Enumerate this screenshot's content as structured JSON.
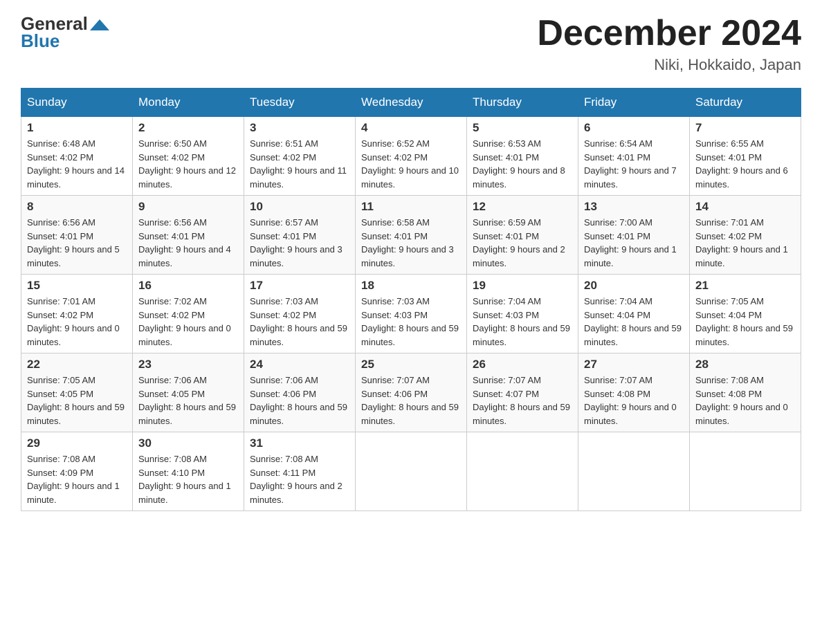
{
  "header": {
    "logo_text_1": "General",
    "logo_text_2": "Blue",
    "month_title": "December 2024",
    "location": "Niki, Hokkaido, Japan"
  },
  "weekdays": [
    "Sunday",
    "Monday",
    "Tuesday",
    "Wednesday",
    "Thursday",
    "Friday",
    "Saturday"
  ],
  "weeks": [
    [
      {
        "day": "1",
        "sunrise": "6:48 AM",
        "sunset": "4:02 PM",
        "daylight": "9 hours and 14 minutes."
      },
      {
        "day": "2",
        "sunrise": "6:50 AM",
        "sunset": "4:02 PM",
        "daylight": "9 hours and 12 minutes."
      },
      {
        "day": "3",
        "sunrise": "6:51 AM",
        "sunset": "4:02 PM",
        "daylight": "9 hours and 11 minutes."
      },
      {
        "day": "4",
        "sunrise": "6:52 AM",
        "sunset": "4:02 PM",
        "daylight": "9 hours and 10 minutes."
      },
      {
        "day": "5",
        "sunrise": "6:53 AM",
        "sunset": "4:01 PM",
        "daylight": "9 hours and 8 minutes."
      },
      {
        "day": "6",
        "sunrise": "6:54 AM",
        "sunset": "4:01 PM",
        "daylight": "9 hours and 7 minutes."
      },
      {
        "day": "7",
        "sunrise": "6:55 AM",
        "sunset": "4:01 PM",
        "daylight": "9 hours and 6 minutes."
      }
    ],
    [
      {
        "day": "8",
        "sunrise": "6:56 AM",
        "sunset": "4:01 PM",
        "daylight": "9 hours and 5 minutes."
      },
      {
        "day": "9",
        "sunrise": "6:56 AM",
        "sunset": "4:01 PM",
        "daylight": "9 hours and 4 minutes."
      },
      {
        "day": "10",
        "sunrise": "6:57 AM",
        "sunset": "4:01 PM",
        "daylight": "9 hours and 3 minutes."
      },
      {
        "day": "11",
        "sunrise": "6:58 AM",
        "sunset": "4:01 PM",
        "daylight": "9 hours and 3 minutes."
      },
      {
        "day": "12",
        "sunrise": "6:59 AM",
        "sunset": "4:01 PM",
        "daylight": "9 hours and 2 minutes."
      },
      {
        "day": "13",
        "sunrise": "7:00 AM",
        "sunset": "4:01 PM",
        "daylight": "9 hours and 1 minute."
      },
      {
        "day": "14",
        "sunrise": "7:01 AM",
        "sunset": "4:02 PM",
        "daylight": "9 hours and 1 minute."
      }
    ],
    [
      {
        "day": "15",
        "sunrise": "7:01 AM",
        "sunset": "4:02 PM",
        "daylight": "9 hours and 0 minutes."
      },
      {
        "day": "16",
        "sunrise": "7:02 AM",
        "sunset": "4:02 PM",
        "daylight": "9 hours and 0 minutes."
      },
      {
        "day": "17",
        "sunrise": "7:03 AM",
        "sunset": "4:02 PM",
        "daylight": "8 hours and 59 minutes."
      },
      {
        "day": "18",
        "sunrise": "7:03 AM",
        "sunset": "4:03 PM",
        "daylight": "8 hours and 59 minutes."
      },
      {
        "day": "19",
        "sunrise": "7:04 AM",
        "sunset": "4:03 PM",
        "daylight": "8 hours and 59 minutes."
      },
      {
        "day": "20",
        "sunrise": "7:04 AM",
        "sunset": "4:04 PM",
        "daylight": "8 hours and 59 minutes."
      },
      {
        "day": "21",
        "sunrise": "7:05 AM",
        "sunset": "4:04 PM",
        "daylight": "8 hours and 59 minutes."
      }
    ],
    [
      {
        "day": "22",
        "sunrise": "7:05 AM",
        "sunset": "4:05 PM",
        "daylight": "8 hours and 59 minutes."
      },
      {
        "day": "23",
        "sunrise": "7:06 AM",
        "sunset": "4:05 PM",
        "daylight": "8 hours and 59 minutes."
      },
      {
        "day": "24",
        "sunrise": "7:06 AM",
        "sunset": "4:06 PM",
        "daylight": "8 hours and 59 minutes."
      },
      {
        "day": "25",
        "sunrise": "7:07 AM",
        "sunset": "4:06 PM",
        "daylight": "8 hours and 59 minutes."
      },
      {
        "day": "26",
        "sunrise": "7:07 AM",
        "sunset": "4:07 PM",
        "daylight": "8 hours and 59 minutes."
      },
      {
        "day": "27",
        "sunrise": "7:07 AM",
        "sunset": "4:08 PM",
        "daylight": "9 hours and 0 minutes."
      },
      {
        "day": "28",
        "sunrise": "7:08 AM",
        "sunset": "4:08 PM",
        "daylight": "9 hours and 0 minutes."
      }
    ],
    [
      {
        "day": "29",
        "sunrise": "7:08 AM",
        "sunset": "4:09 PM",
        "daylight": "9 hours and 1 minute."
      },
      {
        "day": "30",
        "sunrise": "7:08 AM",
        "sunset": "4:10 PM",
        "daylight": "9 hours and 1 minute."
      },
      {
        "day": "31",
        "sunrise": "7:08 AM",
        "sunset": "4:11 PM",
        "daylight": "9 hours and 2 minutes."
      },
      null,
      null,
      null,
      null
    ]
  ]
}
